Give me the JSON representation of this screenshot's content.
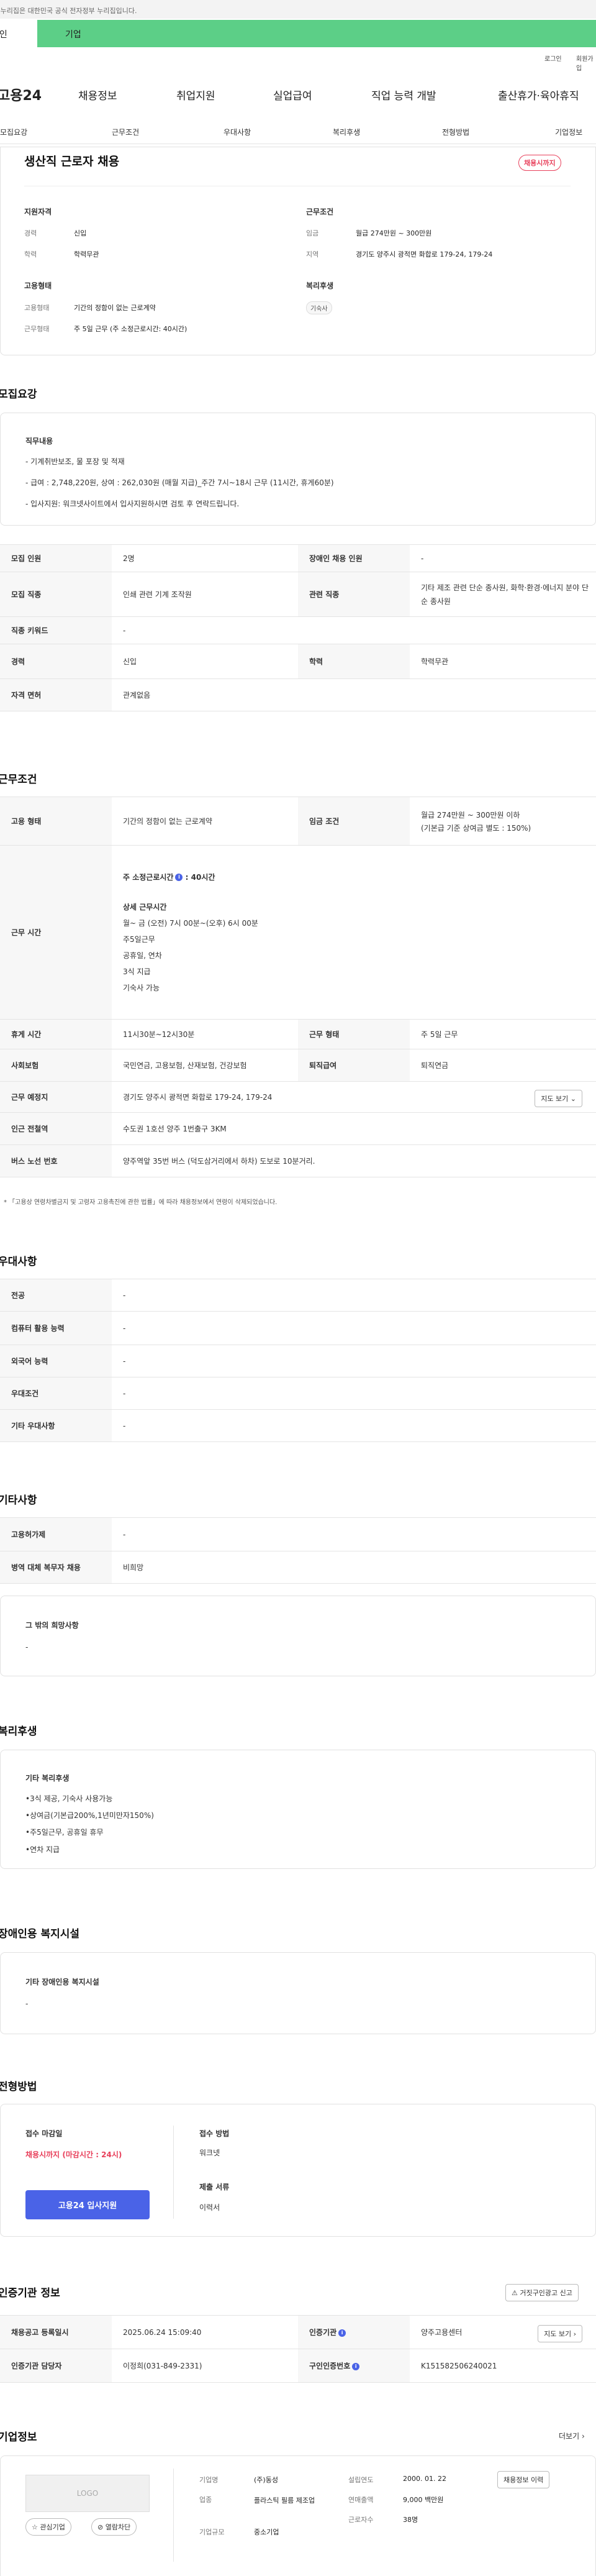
{
  "gov_banner": "이 누리집은 대한민국 공식 전자정부 누리집입니다.",
  "bar": {
    "left": "개인",
    "right": "기업"
  },
  "util": {
    "login": "로그인",
    "join": "회원가입"
  },
  "gnb": {
    "logo": "고용24",
    "items": [
      "채용정보",
      "취업지원",
      "실업급여",
      "직업 능력 개발",
      "출산휴가·육아휴직"
    ]
  },
  "tabs": [
    "모집요강",
    "근무조건",
    "우대사항",
    "복리후생",
    "전형방법",
    "기업정보"
  ],
  "summary": {
    "title": "생산직 근로자 채용",
    "badge": "채용시까지",
    "qual_h": "지원자격",
    "exp_k": "경력",
    "exp_v": "신입",
    "edu_k": "학력",
    "edu_v": "학력무관",
    "emp_h": "고용형태",
    "emp_k": "고용형태",
    "emp_v": "기간의 정함이 없는 근로계약",
    "work_k": "근무형태",
    "work_v": "주 5일 근무 (주 소정근로시간: 40시간)",
    "cond_h": "근무조건",
    "pay_k": "임금",
    "pay_v": "월급 274만원 ~ 300만원",
    "loc_k": "지역",
    "loc_v": "경기도 양주시 광적면 화합로 179-24, 179-24",
    "wel_h": "복리후생",
    "wel_chip": "기숙사"
  },
  "recruit": {
    "h": "모집요강",
    "duty_h": "직무내용",
    "duty_lines": [
      "- 기계취반보조, 물 포장 및 적재",
      "- 급여 : 2,748,220원, 상여 : 262,030원 (매월 지급)_주간 7시~18시 근무 (11시간, 휴게60분)",
      "- 입사지원: 워크넷사이트에서 입사지원하시면 검토 후 연락드립니다."
    ],
    "rows": [
      {
        "k1": "모집 인원",
        "v1": "2명",
        "k2": "장애인 채용 인원",
        "v2": "-"
      },
      {
        "k1": "모집 직종",
        "v1": "인쇄 관련 기계 조작원",
        "k2": "관련 직종",
        "v2": "기타 제조 관련 단순 종사원, 화학·환경·에너지 분야 단순 종사원"
      },
      {
        "k1": "직종 키워드",
        "v1": "-"
      },
      {
        "k1": "경력",
        "v1": "신입",
        "k2": "학력",
        "v2": "학력무관"
      },
      {
        "k1": "자격 면허",
        "v1": "관계없음"
      }
    ]
  },
  "work": {
    "h": "근무조건",
    "emp_k": "고용 형태",
    "emp_v": "기간의 정함이 없는 근로계약",
    "pay_k": "임금 조건",
    "pay_v1": "월급 274만원 ~ 300만원 이하",
    "pay_v2": "(기본급 기준 상여금 별도 : 150%)",
    "time_k": "근무 시간",
    "time_main": "주 소정근로시간",
    "time_hours": ": 40시간",
    "detail_h": "상세 근무시간",
    "detail_lines": [
      "월~ 금 (오전) 7시 00분~(오후) 6시 00분",
      "주5일근무",
      "공휴일, 연차",
      "3식 지급",
      "기숙사 가능"
    ],
    "rest_k": "휴게 시간",
    "rest_v": "11시30분~12시30분",
    "form_k": "근무 형태",
    "form_v": "주 5일 근무",
    "ins_k": "사회보험",
    "ins_v": "국민연금, 고용보험, 산재보험, 건강보험",
    "ret_k": "퇴직급여",
    "ret_v": "퇴직연금",
    "place_k": "근무 예정지",
    "place_v": "경기도 양주시 광적면 화합로 179-24, 179-24",
    "map_btn": "지도 보기",
    "sub_k": "인근 전철역",
    "sub_v": "수도권 1호선 양주 1번출구 3KM",
    "bus_k": "버스 노선 번호",
    "bus_v": "양주역앞 35번 버스 (덕도삼거리에서 하차) 도보로 10분거리.",
    "note": "* 「고용상 연령차별금지 및 고령자 고용촉진에 관한 법률」에 따라 채용정보에서 연령이 삭제되었습니다."
  },
  "pref": {
    "h": "우대사항",
    "rows": [
      {
        "k": "전공",
        "v": "-"
      },
      {
        "k": "컴퓨터 활용 능력",
        "v": "-"
      },
      {
        "k": "외국어 능력",
        "v": "-"
      },
      {
        "k": "우대조건",
        "v": "-"
      },
      {
        "k": "기타 우대사항",
        "v": "-"
      }
    ]
  },
  "etc": {
    "h": "기타사항",
    "rows": [
      {
        "k": "고용허가제",
        "v": "-"
      },
      {
        "k": "병역 대체 복무자 채용",
        "v": "비희망"
      }
    ],
    "box_h": "그 밖의 희망사항",
    "box_v": "-"
  },
  "welfare": {
    "h": "복리후생",
    "box_h": "기타 복리후생",
    "lines": [
      "•3식 제공, 기숙사 사용가능",
      "•상여금(기본급200%,1년미만자150%)",
      "•주5일근무, 공휴일 휴무",
      "•연차 지급"
    ]
  },
  "disab": {
    "h": "장애인용 복지시설",
    "box_h": "기타 장애인용 복지시설",
    "box_v": "-"
  },
  "process": {
    "h": "전형방법",
    "dl_k": "접수 마감일",
    "dl_v": "채용시까지 (마감시간 : 24시)",
    "apply_btn": "고용24 입사지원",
    "method_k": "접수 방법",
    "method_v": "워크넷",
    "docs_k": "제출 서류",
    "docs_v": "이력서"
  },
  "cert": {
    "h": "인증기관 정보",
    "report_btn": "거짓구인광고 신고",
    "r1k1": "채용공고 등록일시",
    "r1v1": "2025.06.24 15:09:40",
    "r1k2": "인증기관",
    "r1v2": "양주고용센터",
    "map_btn": "지도 보기",
    "r2k1": "인증기관 담당자",
    "r2v1": "이정희(031-849-2331)",
    "r2k2": "구인인증번호",
    "r2v2": "K151582506240021"
  },
  "company": {
    "h": "기업정보",
    "more": "더보기",
    "logo": "LOGO",
    "fav": "관심기업",
    "block": "열람차단",
    "name_k": "기업명",
    "name_v": "(주)동성",
    "ind_k": "업종",
    "ind_v": "플라스틱 필름 제조업",
    "size_k": "기업규모",
    "size_v": "중소기업",
    "est_k": "설립연도",
    "est_v": "2000. 01. 22",
    "rev_k": "연매출액",
    "rev_v": "9,000 백만원",
    "emp_k": "근로자수",
    "emp_v": "38명",
    "jobs_btn": "채용정보 이력"
  }
}
